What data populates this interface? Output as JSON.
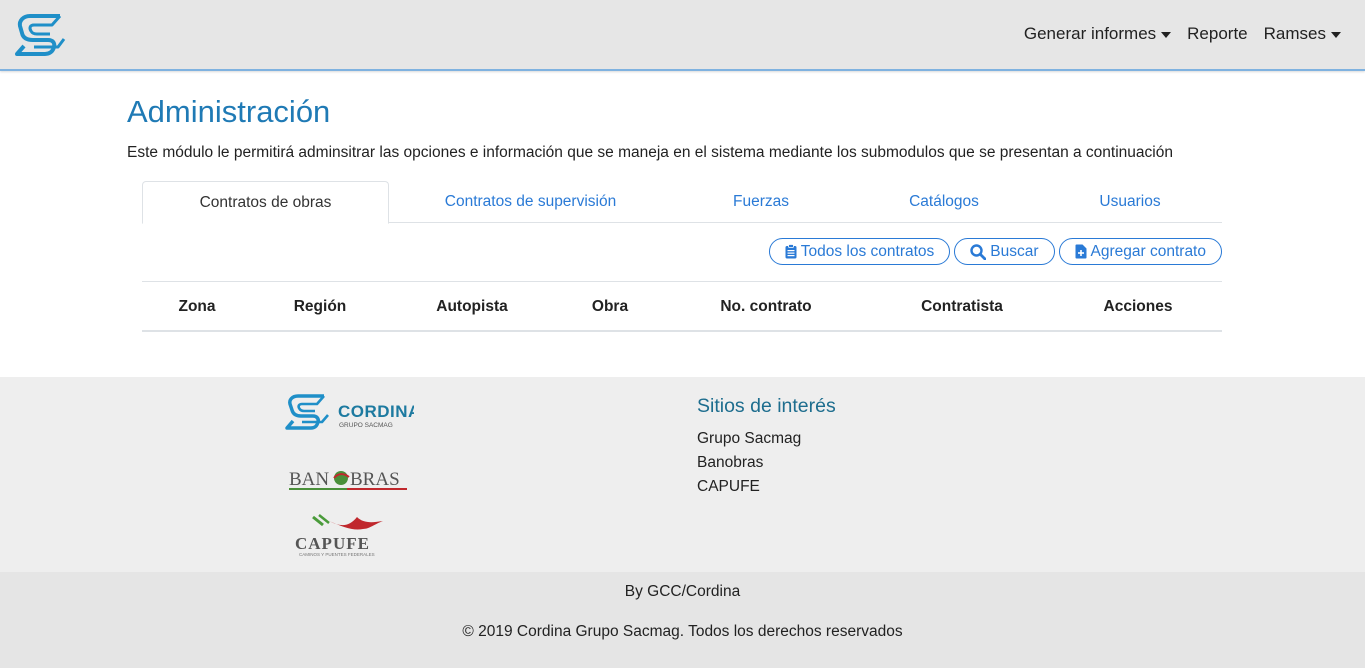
{
  "navbar": {
    "logo_icon": "cordina-s-logo-icon",
    "items": [
      {
        "label": "Generar informes",
        "dropdown": true
      },
      {
        "label": "Reporte",
        "dropdown": false
      },
      {
        "label": "Ramses",
        "dropdown": true
      }
    ]
  },
  "main": {
    "title": "Administración",
    "description": "Este módulo le permitirá adminsitrar las opciones e información que se maneja en el sistema mediante los submodulos que se presentan a continuación",
    "tabs": [
      {
        "label": "Contratos de obras",
        "active": true
      },
      {
        "label": "Contratos de supervisión",
        "active": false
      },
      {
        "label": "Fuerzas",
        "active": false
      },
      {
        "label": "Catálogos",
        "active": false
      },
      {
        "label": "Usuarios",
        "active": false
      }
    ],
    "toolbar": {
      "all_contracts_label": "Todos los contratos",
      "all_contracts_icon": "clipboard-icon",
      "search_label": "Buscar",
      "search_icon": "search-icon",
      "add_contract_label": "Agregar contrato",
      "add_contract_icon": "file-plus-icon"
    },
    "table": {
      "columns": [
        "Zona",
        "Región",
        "Autopista",
        "Obra",
        "No. contrato",
        "Contratista",
        "Acciones"
      ],
      "rows": []
    }
  },
  "footer": {
    "logos": {
      "cordina_name": "CORDINA",
      "cordina_sub": "GRUPO SACMAG",
      "banobras_left": "BAN",
      "banobras_right": "BRAS",
      "capufe": "CAPUFE",
      "capufe_sub": "CAMINOS Y PUENTES FEDERALES"
    },
    "sites_title": "Sitios de interés",
    "sites": [
      "Grupo Sacmag",
      "Banobras",
      "CAPUFE"
    ],
    "by": "By GCC/Cordina",
    "copyright": "© 2019 Cordina Grupo Sacmag. Todos los derechos reservados"
  },
  "colors": {
    "navbar_bg": "#e6e6e6",
    "title": "#1f7ab5",
    "link": "#2a7ad6",
    "footer_top": "#eeeeee",
    "footer_bottom": "#e5e5e5",
    "sites_title": "#1d6d8e"
  }
}
